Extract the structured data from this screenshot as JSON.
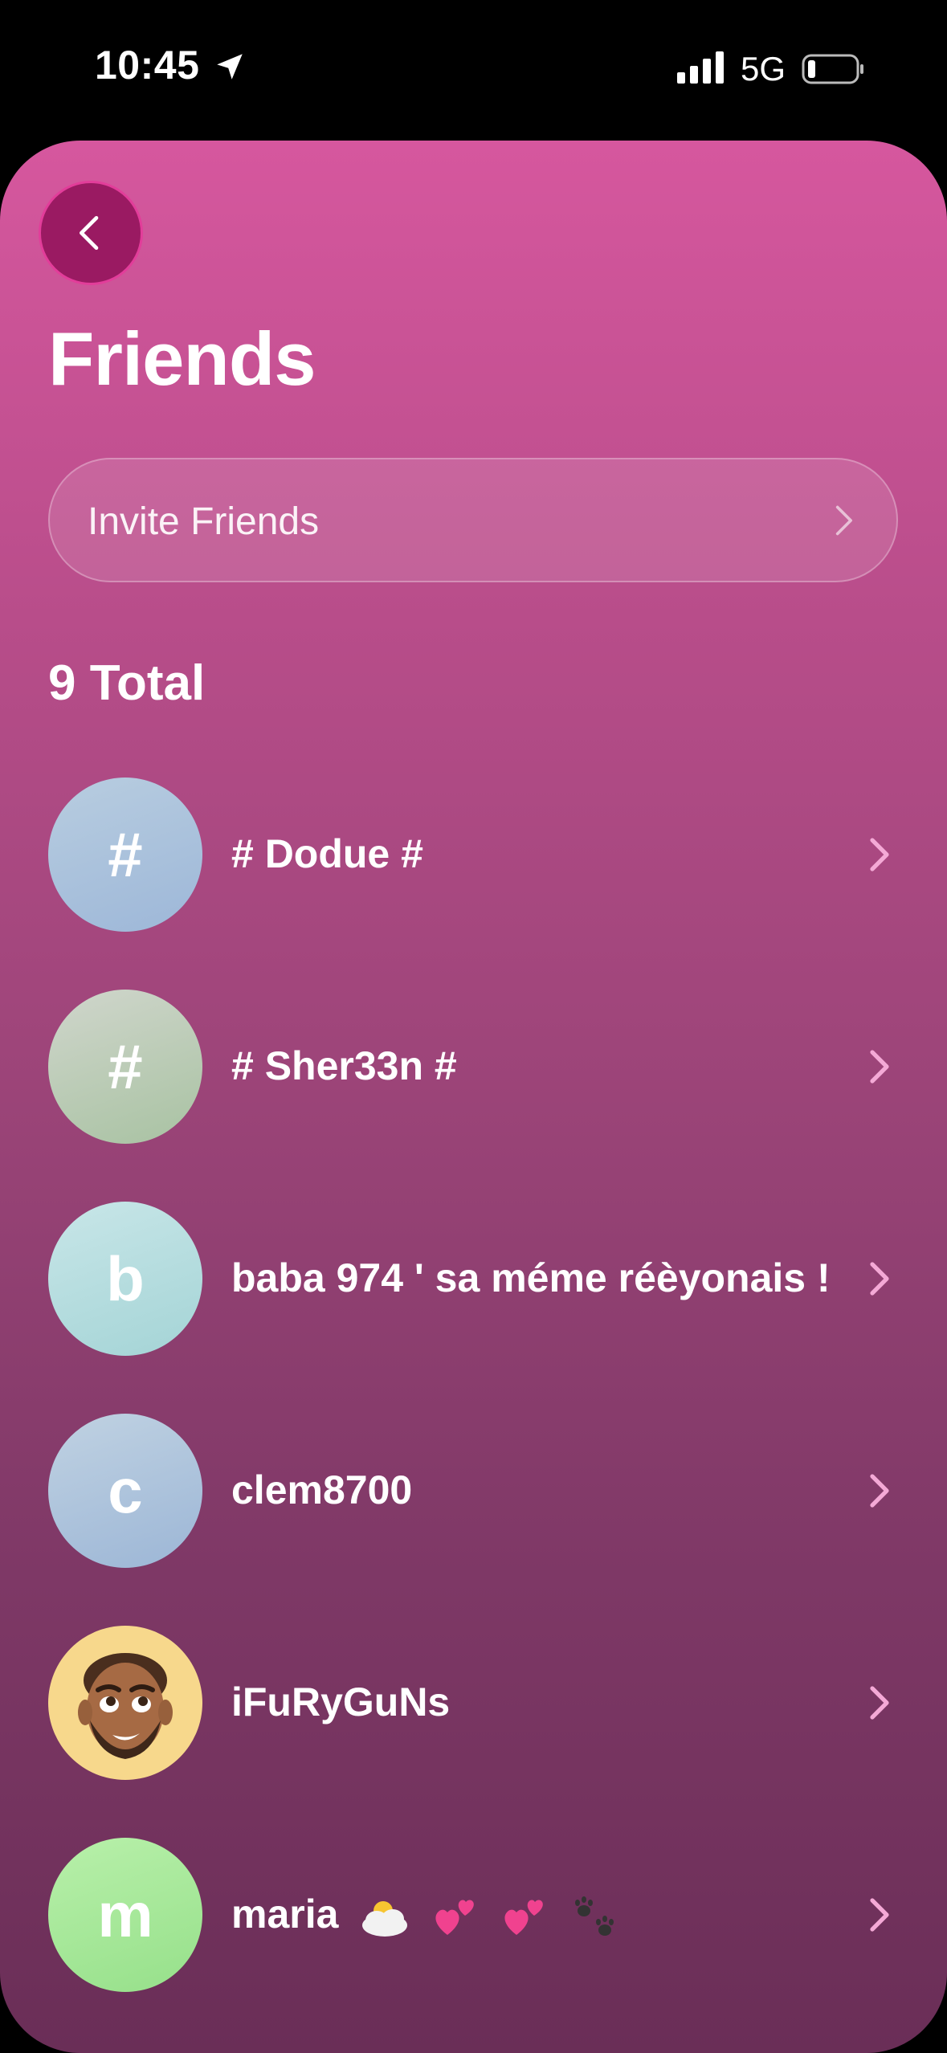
{
  "status_bar": {
    "time": "10:45",
    "network": "5G",
    "battery_level": 0.15,
    "icons": [
      "location-arrow-icon",
      "signal-bars-icon",
      "battery-icon"
    ]
  },
  "header": {
    "back_icon": "chevron-left-icon",
    "title": "Friends"
  },
  "invite": {
    "label": "Invite Friends",
    "icon": "chevron-right-icon"
  },
  "friends": {
    "total_label": "9 Total",
    "items": [
      {
        "name": "# Dodue #",
        "avatar_letter": "#",
        "avatar_color": "#a8c0dc"
      },
      {
        "name": "# Sher33n #",
        "avatar_letter": "#",
        "avatar_color": "#b8ccb0"
      },
      {
        "name": "baba 974 ' sa méme réèyonais !",
        "avatar_letter": "b",
        "avatar_color": "#b0dadd"
      },
      {
        "name": "clem8700",
        "avatar_letter": "c",
        "avatar_color": "#a8c0dc"
      },
      {
        "name": "iFuRyGuNs",
        "avatar_letter": "",
        "avatar_color": "#f7d88c",
        "avatar_icon": "memoji-avatar-icon"
      },
      {
        "name": "maria",
        "avatar_letter": "m",
        "avatar_color": "#a8e89a",
        "name_icons": [
          "sun-behind-cloud-icon",
          "two-hearts-icon",
          "two-hearts-icon",
          "paw-prints-icon"
        ]
      }
    ]
  },
  "colors": {
    "sheet_top": "#d6579e",
    "sheet_bottom": "#6a2e57",
    "back_button": "#9a1a62",
    "back_button_border": "#e23d9a"
  }
}
